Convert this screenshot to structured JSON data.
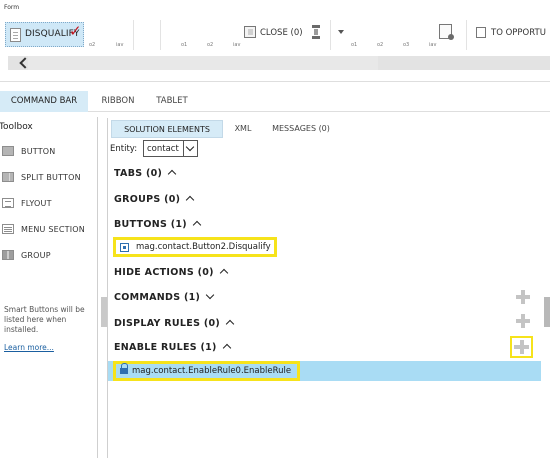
{
  "form_label": "Form",
  "toolbar": {
    "disqualify_label": "DISQUALIFY",
    "close_label": "CLOSE (0)",
    "opportunity_label": "TO OPPORTU",
    "small_labels": [
      "o2",
      "iav",
      "o1",
      "o2",
      "iav",
      "o1",
      "o2",
      "o3",
      "iav"
    ]
  },
  "tabs": [
    "COMMAND BAR",
    "RIBBON",
    "TABLET"
  ],
  "toolbox": {
    "title": "Toolbox",
    "items": [
      "BUTTON",
      "SPLIT BUTTON",
      "FLYOUT",
      "MENU SECTION",
      "GROUP"
    ],
    "icons": [
      "button-icon",
      "split-button-icon",
      "flyout-icon",
      "menu-section-icon",
      "group-icon"
    ],
    "note": "Smart Buttons will be listed here when installed.",
    "learn_more": "Learn more..."
  },
  "panel": {
    "subtabs": [
      "SOLUTION ELEMENTS",
      "XML",
      "MESSAGES (0)"
    ],
    "entity_label": "Entity:",
    "entity_value": "contact",
    "sections": {
      "tabs": "TABS (0)",
      "groups": "GROUPS (0)",
      "buttons": "BUTTONS (1)",
      "hide_actions": "HIDE ACTIONS (0)",
      "commands": "COMMANDS (1)",
      "display_rules": "DISPLAY RULES (0)",
      "enable_rules": "ENABLE RULES (1)"
    },
    "button_item": "mag.contact.Button2.Disqualify",
    "enable_rule_item": "mag.contact.EnableRule0.EnableRule"
  },
  "colors": {
    "highlight": "#d6ebf7",
    "selected_row": "#a9dcf4",
    "annotation": "#f6e31b",
    "check_red": "#c0161f"
  }
}
